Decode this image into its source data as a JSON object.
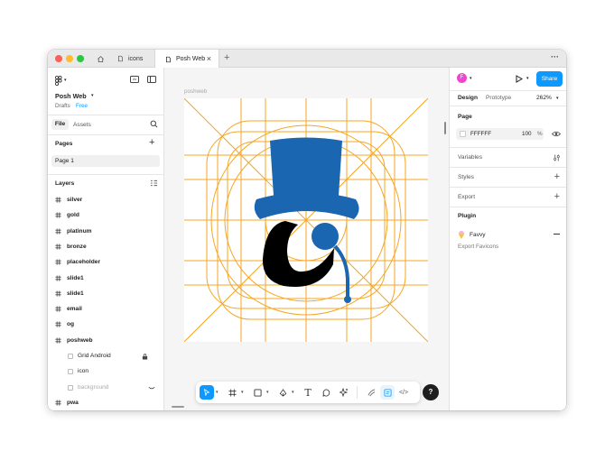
{
  "tabs": [
    {
      "label": "",
      "icon": "home-icon"
    },
    {
      "label": "icons",
      "icon": "figma-file-icon"
    },
    {
      "label": "Posh Web",
      "icon": "figma-file-icon",
      "active": true
    }
  ],
  "window": {
    "more_label": "···"
  },
  "left_panel": {
    "file_name": "Posh Web",
    "drafts_label": "Drafts",
    "plan_label": "Free",
    "tabs": {
      "file": "File",
      "assets": "Assets"
    },
    "pages_title": "Pages",
    "pages": [
      "Page 1"
    ],
    "layers_title": "Layers",
    "layers": [
      {
        "name": "silver",
        "type": "frame"
      },
      {
        "name": "gold",
        "type": "frame"
      },
      {
        "name": "platinum",
        "type": "frame"
      },
      {
        "name": "bronze",
        "type": "frame"
      },
      {
        "name": "placeholder",
        "type": "frame"
      },
      {
        "name": "slide1",
        "type": "frame"
      },
      {
        "name": "slide1",
        "type": "frame"
      },
      {
        "name": "email",
        "type": "frame"
      },
      {
        "name": "og",
        "type": "frame"
      },
      {
        "name": "poshweb",
        "type": "frame"
      },
      {
        "name": "Grid Android",
        "type": "child",
        "locked": true
      },
      {
        "name": "icon",
        "type": "child"
      },
      {
        "name": "background",
        "type": "child",
        "hidden": true
      },
      {
        "name": "pwa",
        "type": "frame"
      }
    ]
  },
  "canvas": {
    "frame_label": "poshweb"
  },
  "right_panel": {
    "avatar_letter": "F",
    "share_label": "Share",
    "design_tab": "Design",
    "prototype_tab": "Prototype",
    "zoom": "262%",
    "page_section": "Page",
    "page_color_hex": "FFFFFF",
    "page_opacity": "100",
    "percent_sign": "%",
    "variables_label": "Variables",
    "styles_label": "Styles",
    "export_label": "Export",
    "plugin_section": "Plugin",
    "plugin_name": "Favvy",
    "plugin_desc": "Export Favicons"
  },
  "help_label": "?",
  "colors": {
    "accent": "#0d99ff",
    "grid_orange": "#f5a623",
    "hat_blue": "#1a66b0",
    "avatar_pink": "#ee46d3",
    "traffic_red": "#ff5f57",
    "traffic_yellow": "#febc2e",
    "traffic_green": "#28c840"
  }
}
